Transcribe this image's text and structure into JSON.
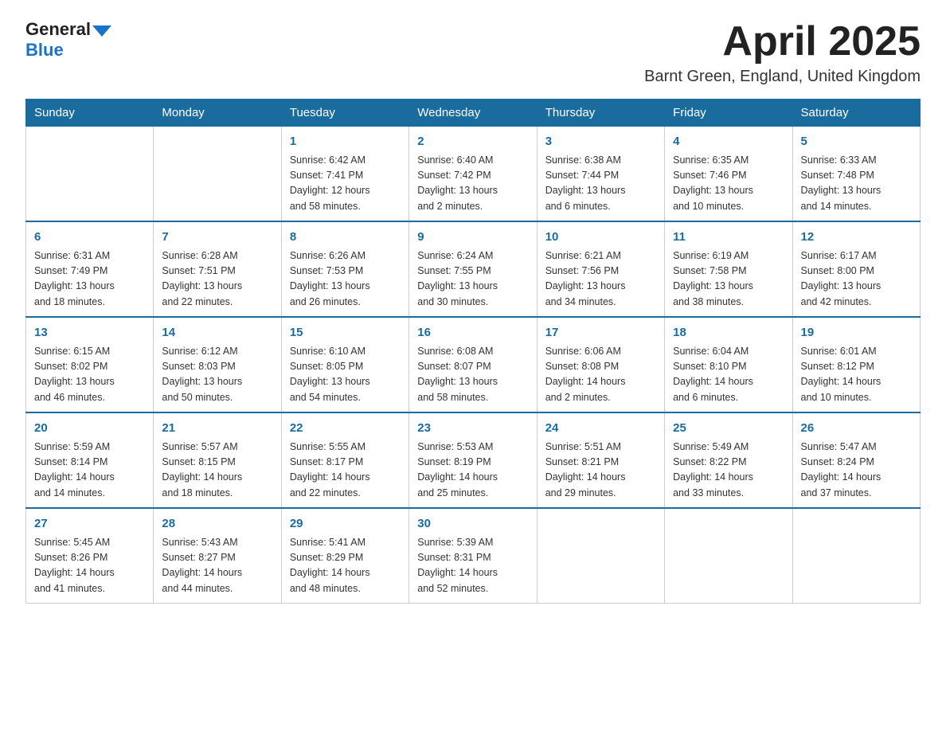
{
  "header": {
    "logo_general": "General",
    "logo_blue": "Blue",
    "month": "April 2025",
    "location": "Barnt Green, England, United Kingdom"
  },
  "days_of_week": [
    "Sunday",
    "Monday",
    "Tuesday",
    "Wednesday",
    "Thursday",
    "Friday",
    "Saturday"
  ],
  "weeks": [
    [
      {
        "day": "",
        "info": []
      },
      {
        "day": "",
        "info": []
      },
      {
        "day": "1",
        "info": [
          "Sunrise: 6:42 AM",
          "Sunset: 7:41 PM",
          "Daylight: 12 hours",
          "and 58 minutes."
        ]
      },
      {
        "day": "2",
        "info": [
          "Sunrise: 6:40 AM",
          "Sunset: 7:42 PM",
          "Daylight: 13 hours",
          "and 2 minutes."
        ]
      },
      {
        "day": "3",
        "info": [
          "Sunrise: 6:38 AM",
          "Sunset: 7:44 PM",
          "Daylight: 13 hours",
          "and 6 minutes."
        ]
      },
      {
        "day": "4",
        "info": [
          "Sunrise: 6:35 AM",
          "Sunset: 7:46 PM",
          "Daylight: 13 hours",
          "and 10 minutes."
        ]
      },
      {
        "day": "5",
        "info": [
          "Sunrise: 6:33 AM",
          "Sunset: 7:48 PM",
          "Daylight: 13 hours",
          "and 14 minutes."
        ]
      }
    ],
    [
      {
        "day": "6",
        "info": [
          "Sunrise: 6:31 AM",
          "Sunset: 7:49 PM",
          "Daylight: 13 hours",
          "and 18 minutes."
        ]
      },
      {
        "day": "7",
        "info": [
          "Sunrise: 6:28 AM",
          "Sunset: 7:51 PM",
          "Daylight: 13 hours",
          "and 22 minutes."
        ]
      },
      {
        "day": "8",
        "info": [
          "Sunrise: 6:26 AM",
          "Sunset: 7:53 PM",
          "Daylight: 13 hours",
          "and 26 minutes."
        ]
      },
      {
        "day": "9",
        "info": [
          "Sunrise: 6:24 AM",
          "Sunset: 7:55 PM",
          "Daylight: 13 hours",
          "and 30 minutes."
        ]
      },
      {
        "day": "10",
        "info": [
          "Sunrise: 6:21 AM",
          "Sunset: 7:56 PM",
          "Daylight: 13 hours",
          "and 34 minutes."
        ]
      },
      {
        "day": "11",
        "info": [
          "Sunrise: 6:19 AM",
          "Sunset: 7:58 PM",
          "Daylight: 13 hours",
          "and 38 minutes."
        ]
      },
      {
        "day": "12",
        "info": [
          "Sunrise: 6:17 AM",
          "Sunset: 8:00 PM",
          "Daylight: 13 hours",
          "and 42 minutes."
        ]
      }
    ],
    [
      {
        "day": "13",
        "info": [
          "Sunrise: 6:15 AM",
          "Sunset: 8:02 PM",
          "Daylight: 13 hours",
          "and 46 minutes."
        ]
      },
      {
        "day": "14",
        "info": [
          "Sunrise: 6:12 AM",
          "Sunset: 8:03 PM",
          "Daylight: 13 hours",
          "and 50 minutes."
        ]
      },
      {
        "day": "15",
        "info": [
          "Sunrise: 6:10 AM",
          "Sunset: 8:05 PM",
          "Daylight: 13 hours",
          "and 54 minutes."
        ]
      },
      {
        "day": "16",
        "info": [
          "Sunrise: 6:08 AM",
          "Sunset: 8:07 PM",
          "Daylight: 13 hours",
          "and 58 minutes."
        ]
      },
      {
        "day": "17",
        "info": [
          "Sunrise: 6:06 AM",
          "Sunset: 8:08 PM",
          "Daylight: 14 hours",
          "and 2 minutes."
        ]
      },
      {
        "day": "18",
        "info": [
          "Sunrise: 6:04 AM",
          "Sunset: 8:10 PM",
          "Daylight: 14 hours",
          "and 6 minutes."
        ]
      },
      {
        "day": "19",
        "info": [
          "Sunrise: 6:01 AM",
          "Sunset: 8:12 PM",
          "Daylight: 14 hours",
          "and 10 minutes."
        ]
      }
    ],
    [
      {
        "day": "20",
        "info": [
          "Sunrise: 5:59 AM",
          "Sunset: 8:14 PM",
          "Daylight: 14 hours",
          "and 14 minutes."
        ]
      },
      {
        "day": "21",
        "info": [
          "Sunrise: 5:57 AM",
          "Sunset: 8:15 PM",
          "Daylight: 14 hours",
          "and 18 minutes."
        ]
      },
      {
        "day": "22",
        "info": [
          "Sunrise: 5:55 AM",
          "Sunset: 8:17 PM",
          "Daylight: 14 hours",
          "and 22 minutes."
        ]
      },
      {
        "day": "23",
        "info": [
          "Sunrise: 5:53 AM",
          "Sunset: 8:19 PM",
          "Daylight: 14 hours",
          "and 25 minutes."
        ]
      },
      {
        "day": "24",
        "info": [
          "Sunrise: 5:51 AM",
          "Sunset: 8:21 PM",
          "Daylight: 14 hours",
          "and 29 minutes."
        ]
      },
      {
        "day": "25",
        "info": [
          "Sunrise: 5:49 AM",
          "Sunset: 8:22 PM",
          "Daylight: 14 hours",
          "and 33 minutes."
        ]
      },
      {
        "day": "26",
        "info": [
          "Sunrise: 5:47 AM",
          "Sunset: 8:24 PM",
          "Daylight: 14 hours",
          "and 37 minutes."
        ]
      }
    ],
    [
      {
        "day": "27",
        "info": [
          "Sunrise: 5:45 AM",
          "Sunset: 8:26 PM",
          "Daylight: 14 hours",
          "and 41 minutes."
        ]
      },
      {
        "day": "28",
        "info": [
          "Sunrise: 5:43 AM",
          "Sunset: 8:27 PM",
          "Daylight: 14 hours",
          "and 44 minutes."
        ]
      },
      {
        "day": "29",
        "info": [
          "Sunrise: 5:41 AM",
          "Sunset: 8:29 PM",
          "Daylight: 14 hours",
          "and 48 minutes."
        ]
      },
      {
        "day": "30",
        "info": [
          "Sunrise: 5:39 AM",
          "Sunset: 8:31 PM",
          "Daylight: 14 hours",
          "and 52 minutes."
        ]
      },
      {
        "day": "",
        "info": []
      },
      {
        "day": "",
        "info": []
      },
      {
        "day": "",
        "info": []
      }
    ]
  ]
}
